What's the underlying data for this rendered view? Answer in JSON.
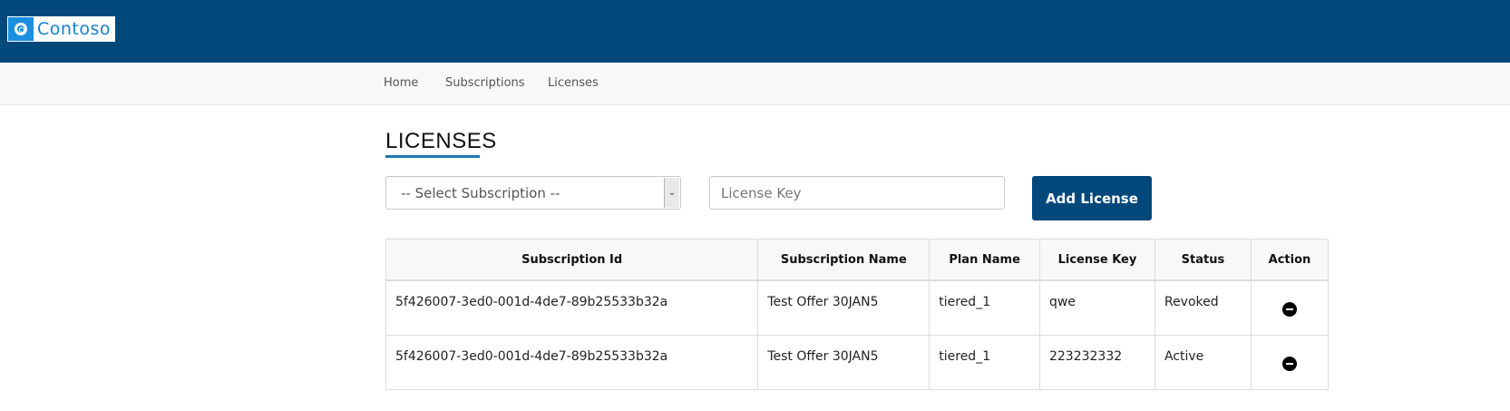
{
  "brand": {
    "name": "Contoso"
  },
  "nav": {
    "items": [
      {
        "label": "Home"
      },
      {
        "label": "Subscriptions"
      },
      {
        "label": "Licenses"
      }
    ]
  },
  "page": {
    "title": "LICENSES"
  },
  "form": {
    "subscription_select": {
      "selected": "-- Select Subscription --",
      "arrow": "⌄"
    },
    "license_key_input": {
      "placeholder": "License Key",
      "value": ""
    },
    "add_button_label": "Add License"
  },
  "table": {
    "headers": [
      "Subscription Id",
      "Subscription Name",
      "Plan Name",
      "License Key",
      "Status",
      "Action"
    ],
    "rows": [
      {
        "subscription_id": "5f426007-3ed0-001d-4de7-89b25533b32a",
        "subscription_name": "Test Offer 30JAN5",
        "plan_name": "tiered_1",
        "license_key": "qwe",
        "status": "Revoked",
        "action_icon": "minus-circle-icon"
      },
      {
        "subscription_id": "5f426007-3ed0-001d-4de7-89b25533b32a",
        "subscription_name": "Test Offer 30JAN5",
        "plan_name": "tiered_1",
        "license_key": "223232332",
        "status": "Active",
        "action_icon": "minus-circle-icon"
      }
    ]
  },
  "colors": {
    "header_bg": "#02487b",
    "accent": "#1f78b4",
    "button_bg": "#02487b"
  }
}
